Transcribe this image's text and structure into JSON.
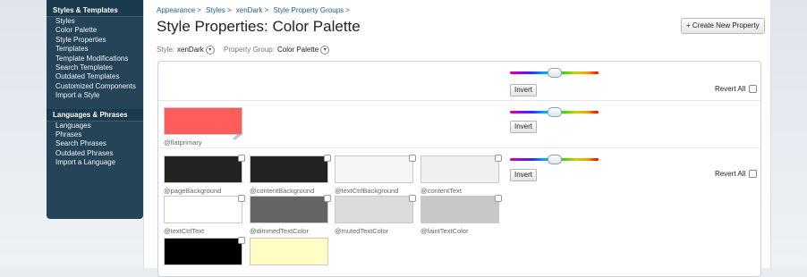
{
  "sidebar": {
    "sections": [
      {
        "title": "Styles & Templates",
        "items": [
          "Styles",
          "Color Palette",
          "Style Properties",
          "Templates",
          "Template Modifications",
          "Search Templates",
          "Outdated Templates",
          "Customized Components",
          "Import a Style"
        ]
      },
      {
        "title": "Languages & Phrases",
        "items": [
          "Languages",
          "Phrases",
          "Search Phrases",
          "Outdated Phrases",
          "Import a Language"
        ]
      }
    ]
  },
  "breadcrumb": [
    "Appearance",
    "Styles",
    "xenDark",
    "Style Property Groups"
  ],
  "page_title": "Style Properties: Color Palette",
  "create_button": "+ Create New Property",
  "filters": {
    "style_label": "Style:",
    "style_value": "xenDark",
    "group_label": "Property Group:",
    "group_value": "Color Palette"
  },
  "controls": {
    "invert_label": "Invert",
    "revert_label": "Revert All"
  },
  "swatches": [
    {
      "name": "@flatprimary",
      "color": "#ff5c5c"
    },
    {
      "name": "@pageBackground",
      "color": "#232323"
    },
    {
      "name": "@contentBackground",
      "color": "#232323"
    },
    {
      "name": "@textCtrlBackground",
      "color": "#f6f6f6"
    },
    {
      "name": "@contentText",
      "color": "#f0f0f0"
    },
    {
      "name": "@textCtrlText",
      "color": "#ffffff"
    },
    {
      "name": "@dimmedTextColor",
      "color": "#646464"
    },
    {
      "name": "@mutedTextColor",
      "color": "#dcdcdc"
    },
    {
      "name": "@faintTextColor",
      "color": "#c8c8c8"
    },
    {
      "name": "",
      "color": "#000000"
    },
    {
      "name": "",
      "color": "#fffcc4"
    }
  ]
}
